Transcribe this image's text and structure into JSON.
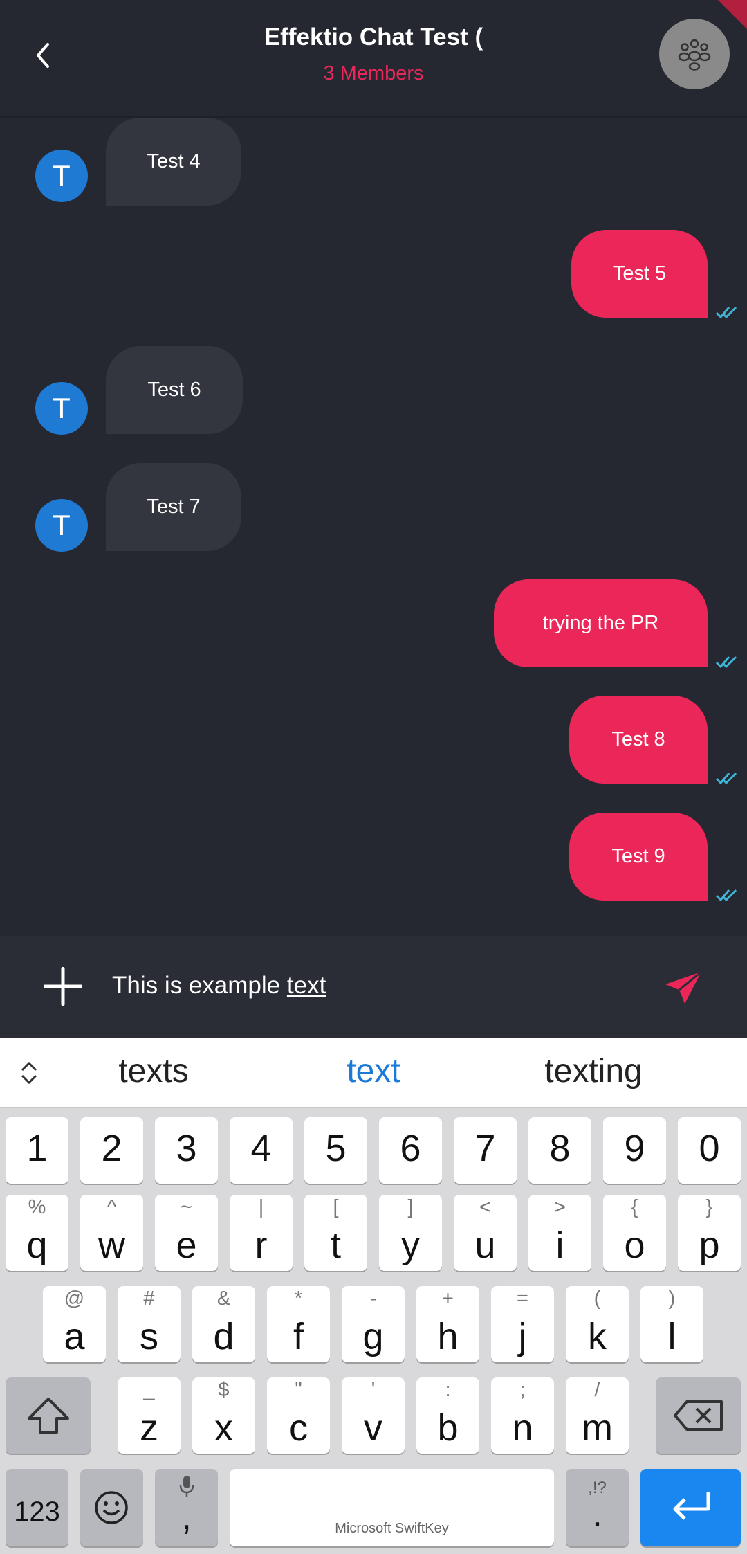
{
  "header": {
    "title": "Effektio Chat Test (",
    "subtitle": "3 Members"
  },
  "messages": [
    {
      "sender": "other",
      "avatar": "T",
      "text": "Test 4"
    },
    {
      "sender": "me",
      "text": "Test 5",
      "status": "read"
    },
    {
      "sender": "other",
      "avatar": "T",
      "text": "Test 6"
    },
    {
      "sender": "other",
      "avatar": "T",
      "text": "Test 7"
    },
    {
      "sender": "me",
      "text": "trying the PR",
      "status": "read"
    },
    {
      "sender": "me",
      "text": "Test 8",
      "status": "read"
    },
    {
      "sender": "me",
      "text": "Test 9",
      "status": "read"
    }
  ],
  "composer": {
    "text_before": "This is example ",
    "text_underlined": "text"
  },
  "keyboard": {
    "suggestions": [
      "texts",
      "text",
      "texting"
    ],
    "numbers": [
      "1",
      "2",
      "3",
      "4",
      "5",
      "6",
      "7",
      "8",
      "9",
      "0"
    ],
    "row1": [
      {
        "k": "q",
        "s": "%"
      },
      {
        "k": "w",
        "s": "^"
      },
      {
        "k": "e",
        "s": "~"
      },
      {
        "k": "r",
        "s": "|"
      },
      {
        "k": "t",
        "s": "["
      },
      {
        "k": "y",
        "s": "]"
      },
      {
        "k": "u",
        "s": "<"
      },
      {
        "k": "i",
        "s": ">"
      },
      {
        "k": "o",
        "s": "{"
      },
      {
        "k": "p",
        "s": "}"
      }
    ],
    "row2": [
      {
        "k": "a",
        "s": "@"
      },
      {
        "k": "s",
        "s": "#"
      },
      {
        "k": "d",
        "s": "&"
      },
      {
        "k": "f",
        "s": "*"
      },
      {
        "k": "g",
        "s": "-"
      },
      {
        "k": "h",
        "s": "+"
      },
      {
        "k": "j",
        "s": "="
      },
      {
        "k": "k",
        "s": "("
      },
      {
        "k": "l",
        "s": ")"
      }
    ],
    "row3": [
      {
        "k": "z",
        "s": "_"
      },
      {
        "k": "x",
        "s": "$"
      },
      {
        "k": "c",
        "s": "\""
      },
      {
        "k": "v",
        "s": "'"
      },
      {
        "k": "b",
        "s": ":"
      },
      {
        "k": "n",
        "s": ";"
      },
      {
        "k": "m",
        "s": "/"
      }
    ],
    "mode_key": "123",
    "comma_key": ",",
    "period_key": ".",
    "period_sec": ",!?",
    "space_label": "Microsoft SwiftKey"
  },
  "colors": {
    "background": "#262831",
    "accent": "#eb2759",
    "incoming_bubble": "#33353f",
    "avatar": "#1f7ad4",
    "read_ticks": "#3fb6d8",
    "enter_key": "#1a86f0"
  }
}
